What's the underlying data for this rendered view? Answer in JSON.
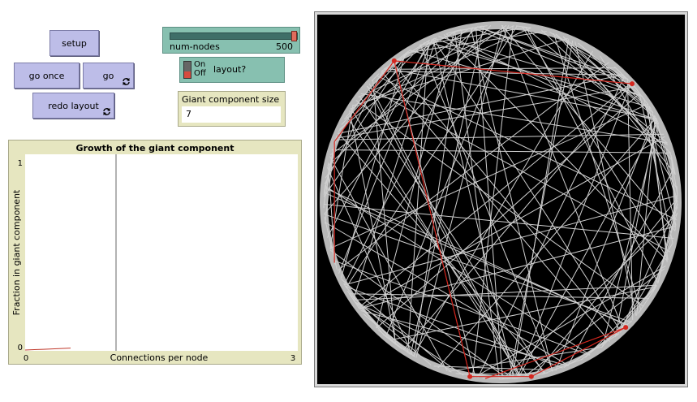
{
  "buttons": {
    "setup": "setup",
    "go_once": "go once",
    "go": "go",
    "redo_layout": "redo layout"
  },
  "slider": {
    "label": "num-nodes",
    "value": "500",
    "fraction": 1.0
  },
  "switch": {
    "on_label": "On",
    "off_label": "Off",
    "label": "layout?",
    "state": "off"
  },
  "monitor": {
    "label": "Giant component size",
    "value": "7"
  },
  "plot": {
    "title": "Growth of the giant component",
    "ylabel": "Fraction in giant component",
    "xlabel": "Connections per node",
    "x_min": "0",
    "x_max": "3",
    "y_min": "0",
    "y_max": "1"
  },
  "chart_data": {
    "type": "line",
    "title": "Growth of the giant component",
    "xlabel": "Connections per node",
    "ylabel": "Fraction in giant component",
    "xlim": [
      0,
      3
    ],
    "ylim": [
      0,
      1
    ],
    "vertical_marker_x": 1,
    "series": [
      {
        "color": "#c0392b",
        "x": [
          0,
          0.1,
          0.2,
          0.3,
          0.4,
          0.5
        ],
        "y": [
          0.004,
          0.006,
          0.008,
          0.01,
          0.012,
          0.014
        ]
      }
    ]
  },
  "colors": {
    "button_bg": "#bdbde8",
    "widget_green": "#87c0b0",
    "monitor_bg": "#e6e6c0",
    "link_color": "#d0d0d0",
    "giant_component_color": "#d4271f",
    "view_bg": "#000000"
  },
  "icons": {
    "forever": "forever-arrows-icon"
  }
}
